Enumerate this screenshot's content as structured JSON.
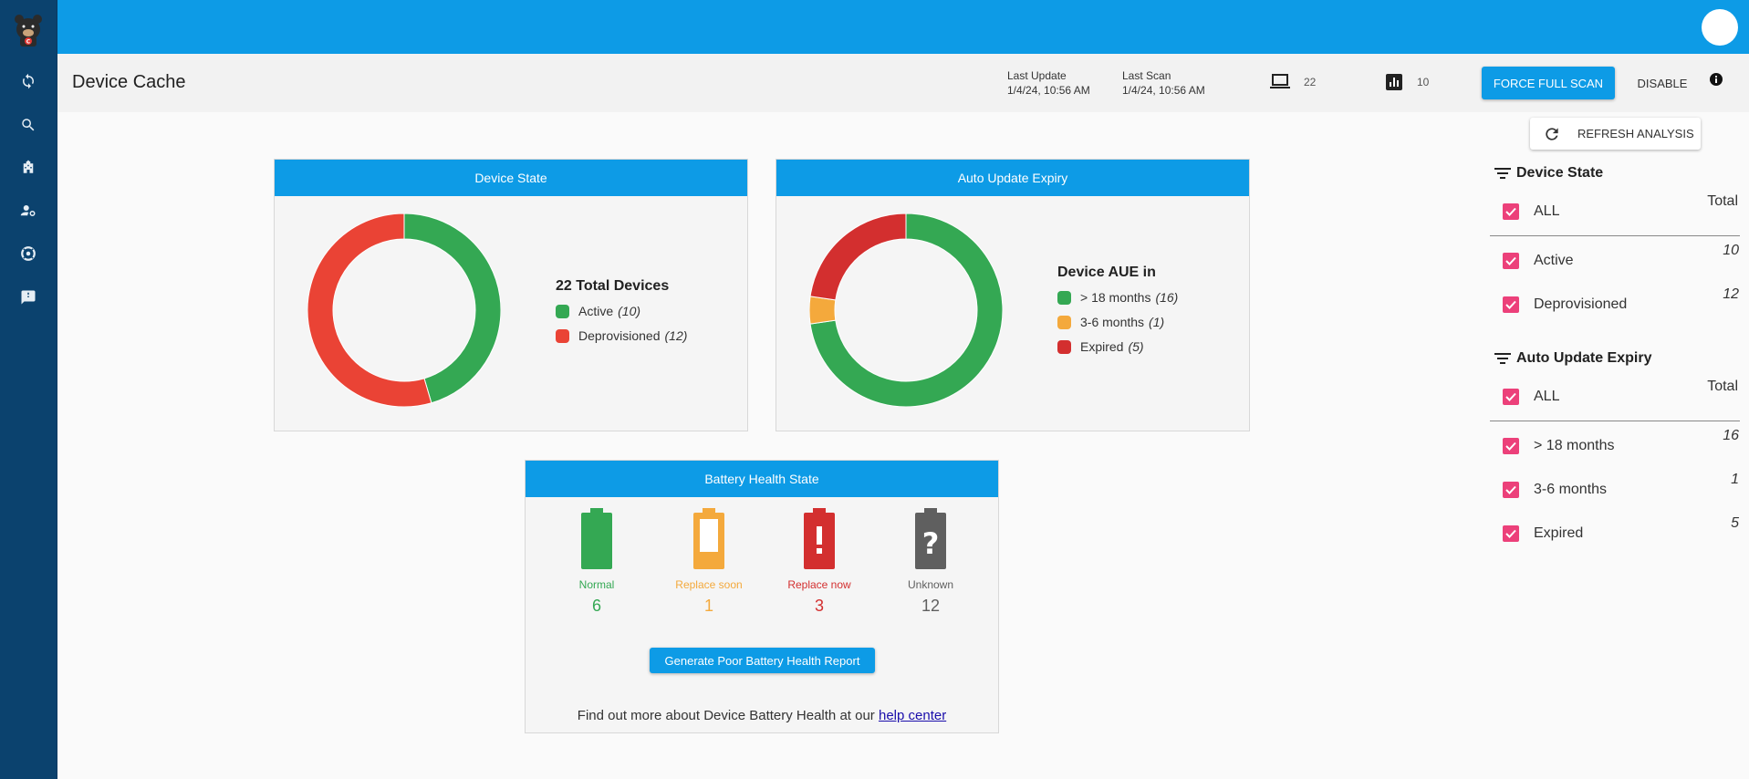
{
  "header": {
    "title": "Device Cache",
    "last_update_label": "Last Update",
    "last_update_value": "1/4/24, 10:56 AM",
    "last_scan_label": "Last Scan",
    "last_scan_value": "1/4/24, 10:56 AM",
    "devices_count": "22",
    "analytics_count": "10",
    "force_scan_label": "FORCE FULL SCAN",
    "disable_label": "DISABLE"
  },
  "device_state_card": {
    "title": "Device State",
    "legend_title": "22 Total Devices",
    "items": [
      {
        "label": "Active",
        "count": "(10)",
        "color": "#34a853",
        "value": 10
      },
      {
        "label": "Deprovisioned",
        "count": "(12)",
        "color": "#ea4335",
        "value": 12
      }
    ]
  },
  "aue_card": {
    "title": "Auto Update Expiry",
    "legend_title": "Device AUE in",
    "items": [
      {
        "label": "> 18 months",
        "count": "(16)",
        "color": "#34a853",
        "value": 16
      },
      {
        "label": "3-6 months",
        "count": "(1)",
        "color": "#f4a93c",
        "value": 1
      },
      {
        "label": "Expired",
        "count": "(5)",
        "color": "#d32f2f",
        "value": 5
      }
    ]
  },
  "battery_card": {
    "title": "Battery Health State",
    "states": [
      {
        "label": "Normal",
        "value": "6",
        "color": "#34a853",
        "icon": "battery-full-icon"
      },
      {
        "label": "Replace soon",
        "value": "1",
        "color": "#f4a93c",
        "icon": "battery-low-icon"
      },
      {
        "label": "Replace now",
        "value": "3",
        "color": "#d32f2f",
        "icon": "battery-alert-icon"
      },
      {
        "label": "Unknown",
        "value": "12",
        "color": "#5f5f5f",
        "icon": "battery-unknown-icon"
      }
    ],
    "report_button": "Generate Poor Battery Health Report",
    "help_text": "Find out more about Device Battery Health at our",
    "help_link": "help center"
  },
  "filters": {
    "refresh_label": "REFRESH ANALYSIS",
    "device_state": {
      "title": "Device State",
      "all_label": "ALL",
      "total_label": "Total",
      "items": [
        {
          "label": "Active",
          "value": "10"
        },
        {
          "label": "Deprovisioned",
          "value": "12"
        }
      ]
    },
    "aue": {
      "title": "Auto Update Expiry",
      "all_label": "ALL",
      "total_label": "Total",
      "items": [
        {
          "label": "> 18 months",
          "value": "16"
        },
        {
          "label": "3-6 months",
          "value": "1"
        },
        {
          "label": "Expired",
          "value": "5"
        }
      ]
    }
  },
  "sidebar": {
    "items": [
      {
        "icon": "sync-icon"
      },
      {
        "icon": "search-icon"
      },
      {
        "icon": "school-icon"
      },
      {
        "icon": "manage-accounts-icon"
      },
      {
        "icon": "support-icon"
      },
      {
        "icon": "feedback-icon"
      }
    ]
  },
  "colors": {
    "primary": "#0d9be6",
    "sidebar": "#0b426e",
    "checkbox": "#ec407a"
  }
}
